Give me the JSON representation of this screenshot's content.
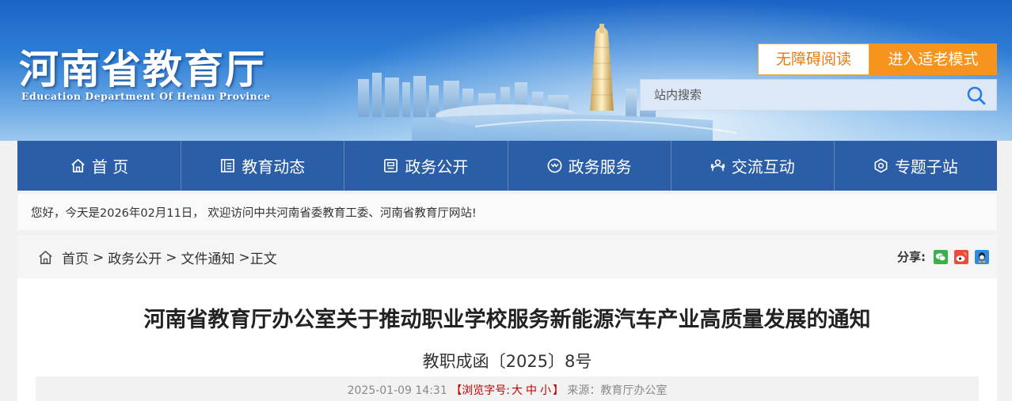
{
  "header": {
    "logo_cn": "河南省教育厅",
    "logo_en": "Education Department Of Henan Province",
    "accessibility_button": "无障碍阅读",
    "elder_mode_button": "进入适老模式",
    "search_placeholder": "站内搜索",
    "accent_color": "#f7941d"
  },
  "nav": {
    "items": [
      {
        "label": "首 页",
        "icon": "home-icon"
      },
      {
        "label": "教育动态",
        "icon": "news-icon"
      },
      {
        "label": "政务公开",
        "icon": "document-icon"
      },
      {
        "label": "政务服务",
        "icon": "service-icon"
      },
      {
        "label": "交流互动",
        "icon": "interaction-icon"
      },
      {
        "label": "专题子站",
        "icon": "subsite-icon"
      }
    ],
    "background": "#2c5ea8"
  },
  "welcome": {
    "text": "您好，今天是2026年02月11日， 欢迎访问中共河南省委教育工委、河南省教育厅网站!"
  },
  "breadcrumb": {
    "items": [
      "首页",
      "政务公开",
      "文件通知"
    ],
    "current": "正文",
    "separator": ">"
  },
  "share": {
    "label": "分享:",
    "targets": [
      "wechat-icon",
      "weibo-icon",
      "qq-icon"
    ]
  },
  "article": {
    "title": "河南省教育厅办公室关于推动职业学校服务新能源汽车产业高质量发展的通知",
    "doc_number": "教职成函〔2025〕8号",
    "datetime": "2025-01-09 14:31",
    "font_size_label": "【浏览字号:",
    "font_sizes": [
      "大",
      "中",
      "小"
    ],
    "font_size_end": "】",
    "source": "来源：教育厅办公室"
  }
}
